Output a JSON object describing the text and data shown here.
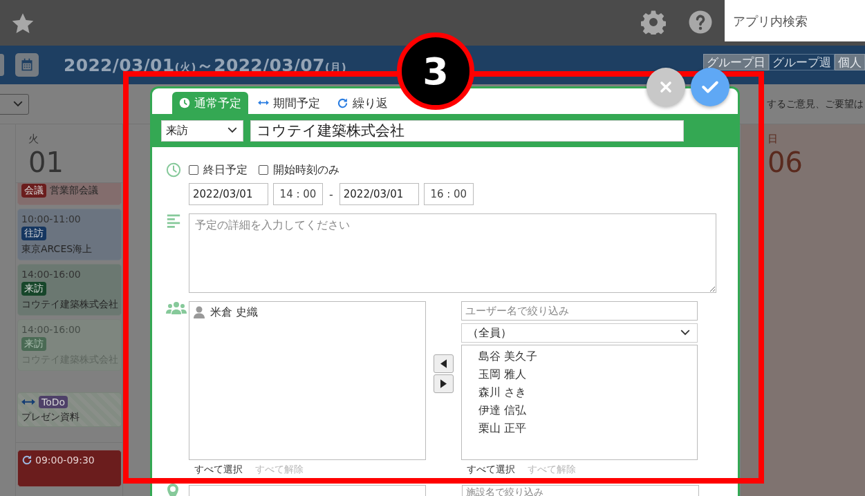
{
  "top_bar": {
    "search": {
      "placeholder": "アプリ内検索"
    }
  },
  "toolbar": {
    "date_range": {
      "start": "2022/03/01",
      "start_day": "(火)",
      "separator": "～",
      "end": "2022/03/07",
      "end_day": "(月)"
    },
    "view_tabs": [
      {
        "label": "グループ日",
        "selected": false
      },
      {
        "label": "グループ週",
        "selected": true
      },
      {
        "label": "個人",
        "selected": false
      }
    ]
  },
  "notice": "するご意見、ご要望は",
  "calendar": {
    "columns": [
      {
        "kind": "weekday",
        "weekday": "火",
        "date": "01",
        "events": [
          {
            "kind": "event",
            "badge": "会議",
            "color": "#6b1d1d",
            "title": "営業部会議",
            "faded": false
          },
          {
            "kind": "event",
            "time": "10:00-11:00",
            "badge": "往訪",
            "color": "#153660",
            "title": "東京ARCES海上",
            "faded": false
          },
          {
            "kind": "event",
            "time": "14:00-16:00",
            "badge": "来訪",
            "color": "#17462a",
            "title": "コウテイ建築株式会社",
            "faded": false
          },
          {
            "kind": "event",
            "time": "14:00-16:00",
            "badge": "来訪",
            "color": "#4a6a54",
            "title": "コウテイ建築株式会社",
            "faded": true
          },
          {
            "kind": "todo",
            "badge": "ToDo",
            "color": "#4e4068",
            "title": "プレゼン資料"
          },
          {
            "kind": "repeat",
            "time": "09:00-09:30",
            "color": "#6b1d1d"
          }
        ]
      },
      {
        "kind": "sunday",
        "weekday": "日",
        "date": "06"
      }
    ]
  },
  "dialog": {
    "tabs": [
      {
        "kind": "normal",
        "label": "通常予定",
        "selected": true
      },
      {
        "kind": "period",
        "label": "期間予定",
        "selected": false
      },
      {
        "kind": "repeat",
        "label": "繰り返",
        "selected": false
      }
    ],
    "category": "来訪",
    "title": "コウテイ建築株式会社",
    "options": [
      {
        "label": "終日予定",
        "checked": false
      },
      {
        "label": "開始時刻のみ",
        "checked": false
      }
    ],
    "start_date": "2022/03/01",
    "start_time": "14 : 00",
    "range_separator": "-",
    "end_date": "2022/03/01",
    "end_time": "16 : 00",
    "details": {
      "placeholder": "予定の詳細を入力してください"
    },
    "members": {
      "selected": [
        {
          "name": "米倉 史織"
        }
      ],
      "selected_links": [
        {
          "label": "すべて選択",
          "disabled": false
        },
        {
          "label": "すべて解除",
          "disabled": true
        }
      ],
      "filter": {
        "placeholder": "ユーザー名で絞り込み"
      },
      "group": "（全員）",
      "candidates": [
        {
          "name": "島谷 美久子"
        },
        {
          "name": "玉岡 雅人"
        },
        {
          "name": "森川 さき"
        },
        {
          "name": "伊達 信弘"
        },
        {
          "name": "栗山 正平"
        }
      ],
      "candidate_links": [
        {
          "label": "すべて選択",
          "disabled": false
        },
        {
          "label": "すべて解除",
          "disabled": true
        }
      ]
    },
    "facilities": {
      "filter": {
        "placeholder": "施設名で絞り込み"
      }
    }
  },
  "annotation": {
    "step": "3"
  }
}
